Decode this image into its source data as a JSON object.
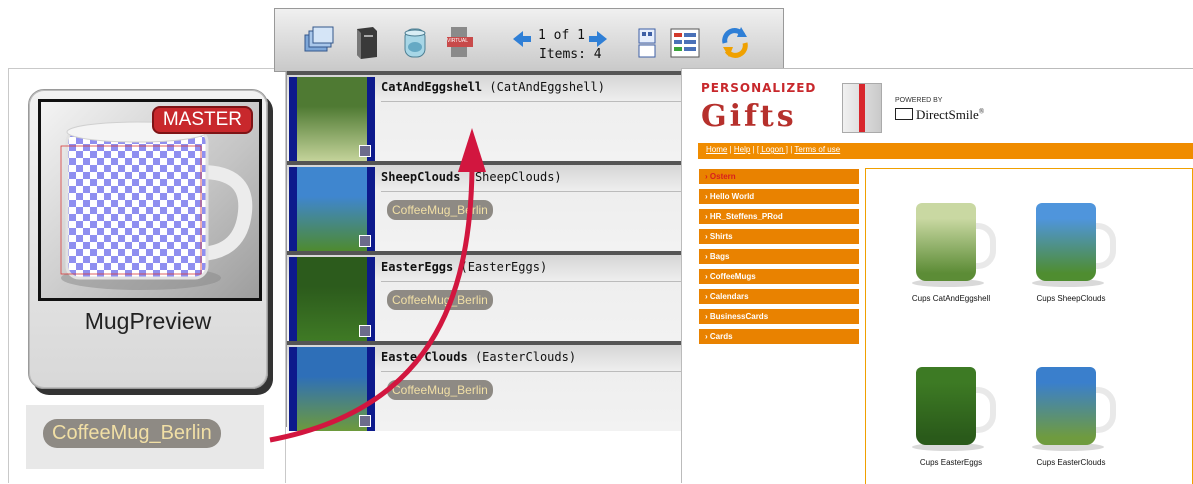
{
  "master": {
    "badge": "MASTER",
    "title": "MugPreview",
    "dataset_label": "CoffeeMug_Berlin"
  },
  "toolbar": {
    "icons": [
      "card-stack-icon",
      "document-cabinet-icon",
      "database-jar-icon",
      "virtual-printer-icon",
      "grid-view-icon",
      "list-view-icon",
      "refresh-icon"
    ],
    "virtual_label": "VIRTUAL",
    "pager": "1 of 1",
    "items": "Items: 4"
  },
  "jobs": [
    {
      "name": "CatAndEggshell",
      "sub": "(CatAndEggshell)",
      "dataset": "",
      "thumb_colors": [
        "#4f7a33",
        "#c4d39a"
      ]
    },
    {
      "name": "SheepClouds",
      "sub": "(SheepClouds)",
      "dataset": "CoffeeMug_Berlin",
      "thumb_colors": [
        "#3f86cf",
        "#4e8a2f"
      ]
    },
    {
      "name": "EasterEggs",
      "sub": "(EasterEggs)",
      "dataset": "CoffeeMug_Berlin",
      "thumb_colors": [
        "#2c5b1c",
        "#3f7a25"
      ]
    },
    {
      "name": "EasterClouds",
      "sub": "(EasterClouds)",
      "dataset": "CoffeeMug_Berlin",
      "thumb_colors": [
        "#2e6fb8",
        "#6d9a3c"
      ]
    }
  ],
  "shop": {
    "logo_top": "PERSONALIZED",
    "logo_main": "Gifts",
    "powered_by": "POWERED BY",
    "brand": "DirectSmile",
    "brand_mark": "®",
    "nav": [
      "Home",
      "Help",
      "[ Logon ]",
      "Terms of use"
    ],
    "categories": [
      "Ostern",
      "Hello World",
      "HR_Steffens_PRod",
      "Shirts",
      "Bags",
      "CoffeeMugs",
      "Calendars",
      "BusinessCards",
      "Cards"
    ],
    "products": [
      {
        "caption": "Cups CatAndEggshell",
        "colors": [
          "#c9d8a2",
          "#5c8c36"
        ]
      },
      {
        "caption": "Cups SheepClouds",
        "colors": [
          "#4f95dc",
          "#4f8d30"
        ]
      },
      {
        "caption": "Cups EasterEggs",
        "colors": [
          "#3d7a24",
          "#2a5a1a"
        ]
      },
      {
        "caption": "Cups EasterClouds",
        "colors": [
          "#3a7fcc",
          "#6f9b3f"
        ]
      }
    ]
  },
  "colors": {
    "accent_red": "#d2163f",
    "shop_orange": "#f08c00",
    "pill_bg": "#8e8a84",
    "pill_text": "#f1dfa5"
  }
}
